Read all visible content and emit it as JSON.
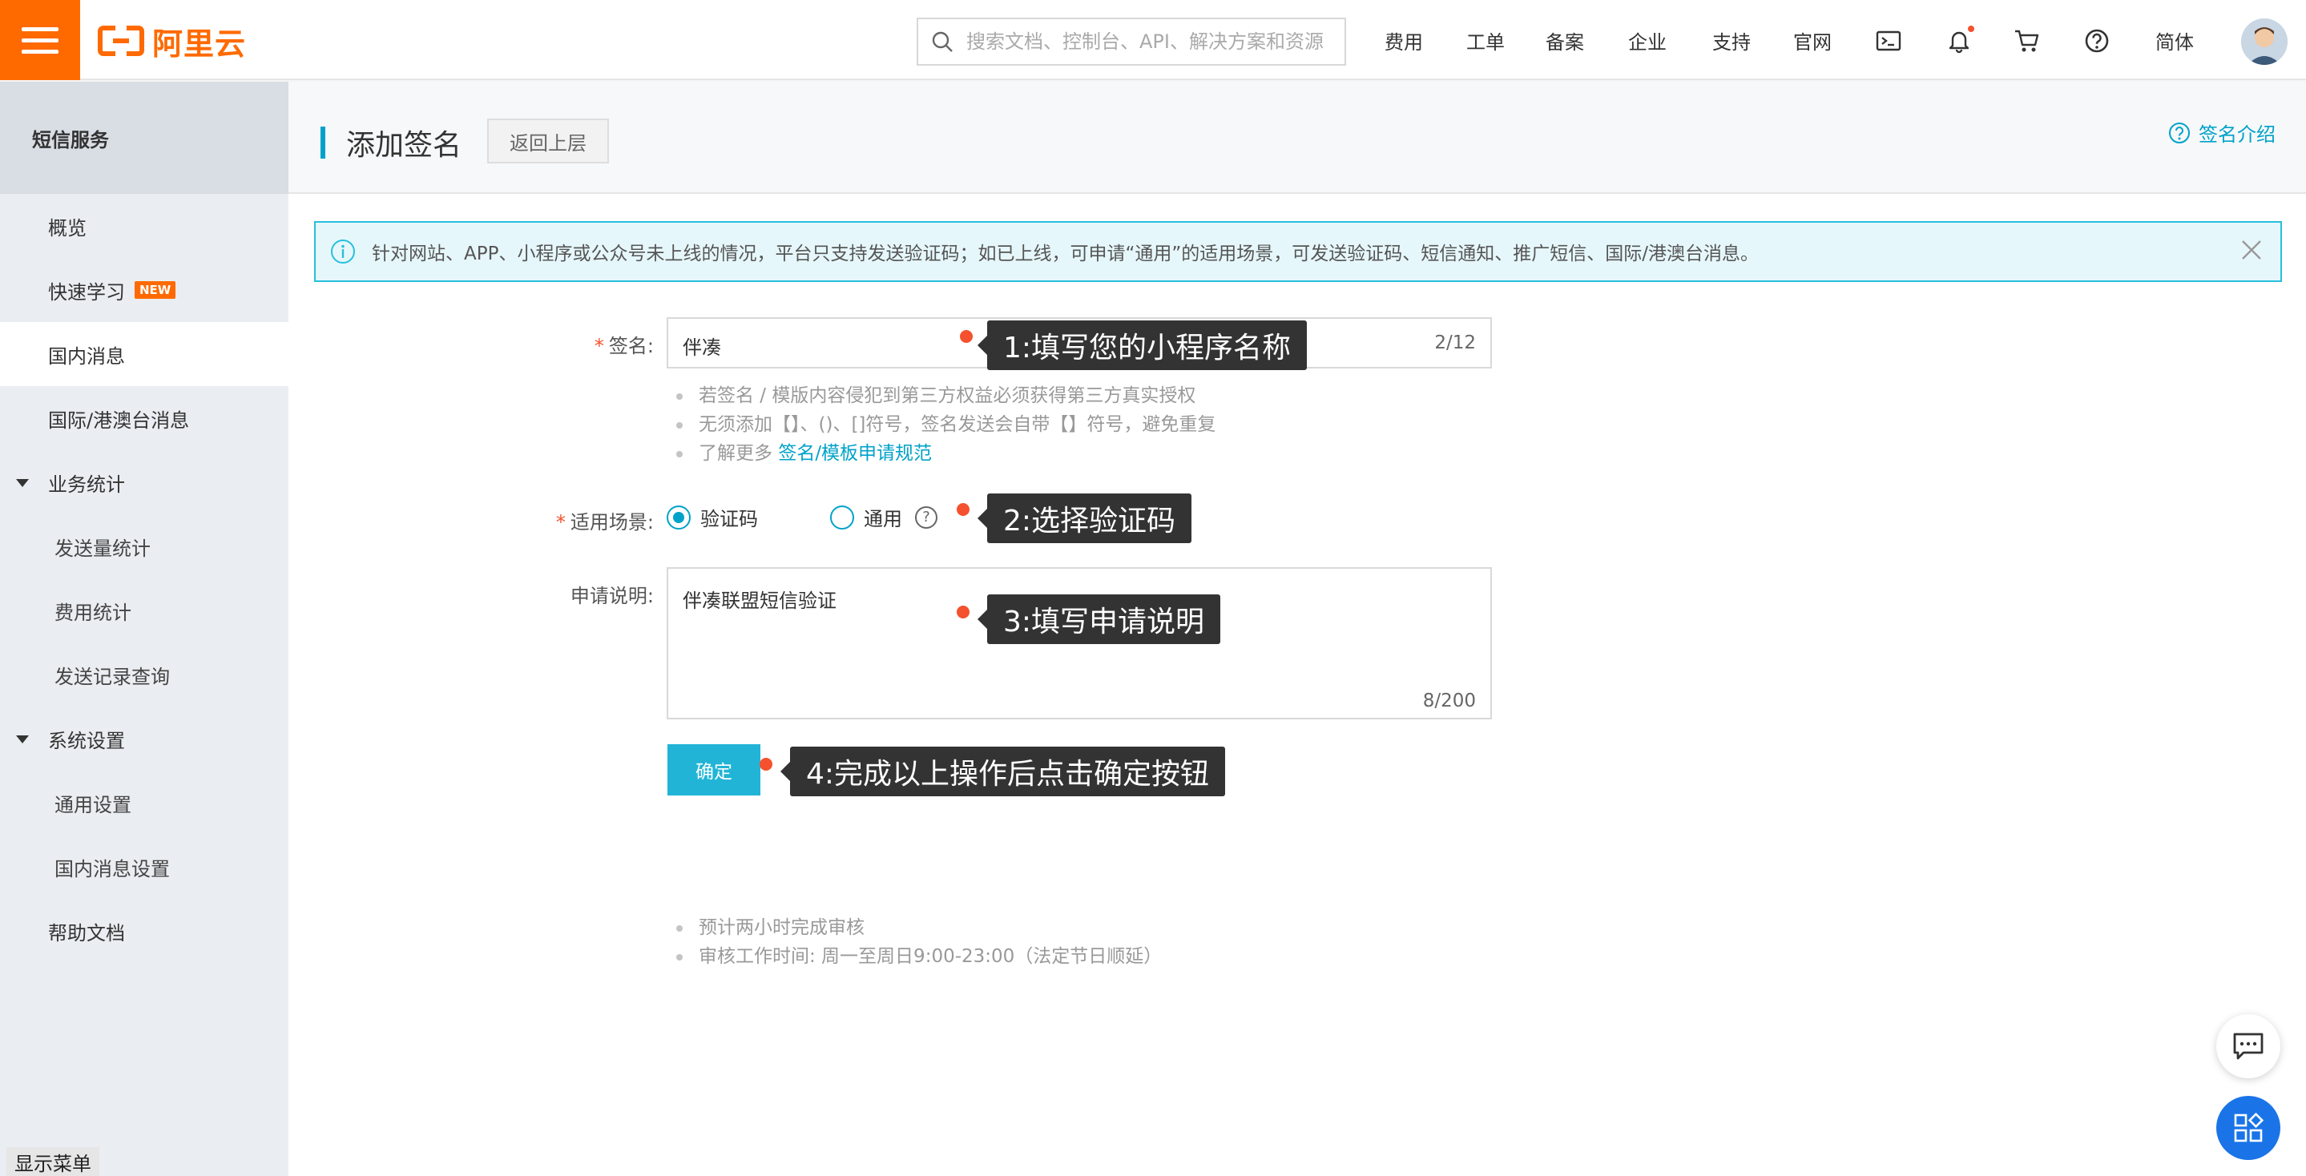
{
  "header": {
    "logo_text": "阿里云",
    "search_placeholder": "搜索文档、控制台、API、解决方案和资源",
    "nav": [
      "费用",
      "工单",
      "备案",
      "企业",
      "支持",
      "官网"
    ],
    "language": "简体",
    "icons": [
      "terminal-icon",
      "bell-icon",
      "cart-icon",
      "help-icon"
    ],
    "accent_color": "#ff6a00"
  },
  "sidebar": {
    "title": "短信服务",
    "items": [
      {
        "label": "概览"
      },
      {
        "label": "快速学习",
        "badge": "NEW"
      },
      {
        "label": "国内消息",
        "active": true
      },
      {
        "label": "国际/港澳台消息"
      },
      {
        "label": "业务统计",
        "group": true
      },
      {
        "label": "发送量统计"
      },
      {
        "label": "费用统计"
      },
      {
        "label": "发送记录查询"
      },
      {
        "label": "系统设置",
        "group": true
      },
      {
        "label": "通用设置"
      },
      {
        "label": "国内消息设置"
      },
      {
        "label": "帮助文档"
      }
    ],
    "show_menu": "显示菜单"
  },
  "page": {
    "title": "添加签名",
    "back_button": "返回上层",
    "help_link": "签名介绍",
    "alert": "针对网站、APP、小程序或公众号未上线的情况，平台只支持发送验证码；如已上线，可申请“通用”的适用场景，可发送验证码、短信通知、推广短信、国际/港澳台消息。"
  },
  "form": {
    "signature": {
      "label": "签名:",
      "value": "伴凑",
      "count": "2/12",
      "hints": [
        "若签名 / 模版内容侵犯到第三方权益必须获得第三方真实授权",
        "无须添加【】、()、[]符号，签名发送会自带【】符号，避免重复"
      ],
      "hint_more_prefix": "了解更多 ",
      "hint_more_link": "签名/模板申请规范"
    },
    "scene": {
      "label": "适用场景:",
      "option_1": "验证码",
      "option_2": "通用",
      "selected": "验证码"
    },
    "description": {
      "label": "申请说明:",
      "value": "伴凑联盟短信验证",
      "count": "8/200"
    },
    "submit": "确定",
    "notes": [
      "预计两小时完成审核",
      "审核工作时间: 周一至周日9:00-23:00（法定节日顺延）"
    ]
  },
  "annotations": {
    "tip_1": "1:填写您的小程序名称",
    "tip_2": "2:选择验证码",
    "tip_3": "3:填写申请说明",
    "tip_4": "4:完成以上操作后点击确定按钮"
  }
}
